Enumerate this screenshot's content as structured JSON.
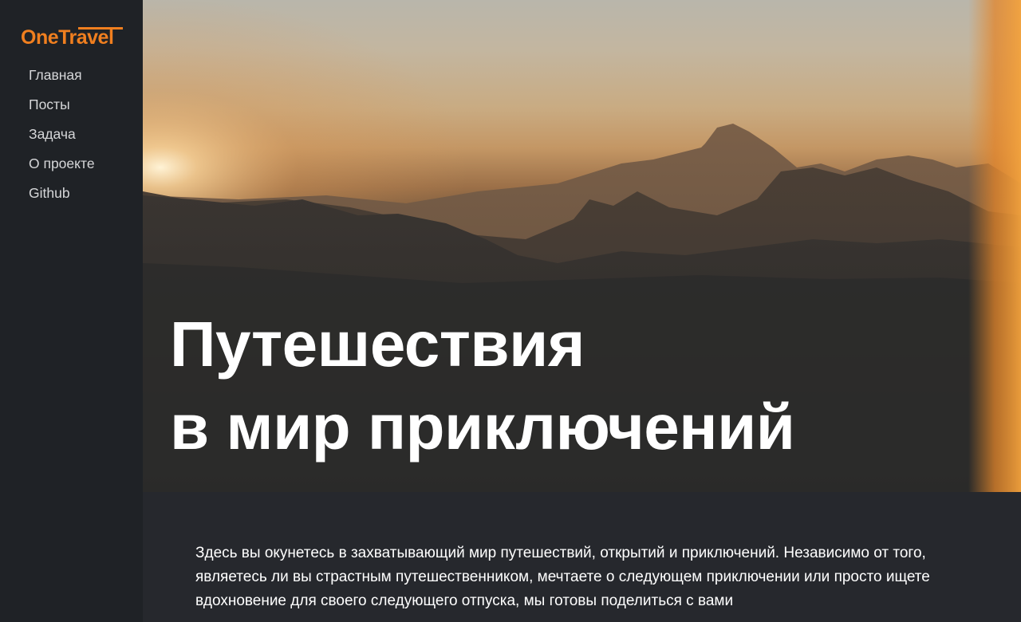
{
  "sidebar": {
    "logo": "OneTravel",
    "items": [
      {
        "label": "Главная"
      },
      {
        "label": "Посты"
      },
      {
        "label": "Задача"
      },
      {
        "label": "О проекте"
      },
      {
        "label": "Github"
      }
    ]
  },
  "hero": {
    "title_line1": "Путешествия",
    "title_line2": "в мир приключений"
  },
  "content": {
    "intro": "Здесь вы окунетесь в захватывающий мир путешествий, открытий и приключений. Независимо от того, являетесь ли вы страстным путешественником, мечтаете о следующем приключении или просто ищете вдохновение для своего следующего отпуска, мы готовы поделиться с вами"
  },
  "colors": {
    "accent": "#f07f1f",
    "sidebar_bg": "#1f2226",
    "page_bg": "#26282d"
  }
}
